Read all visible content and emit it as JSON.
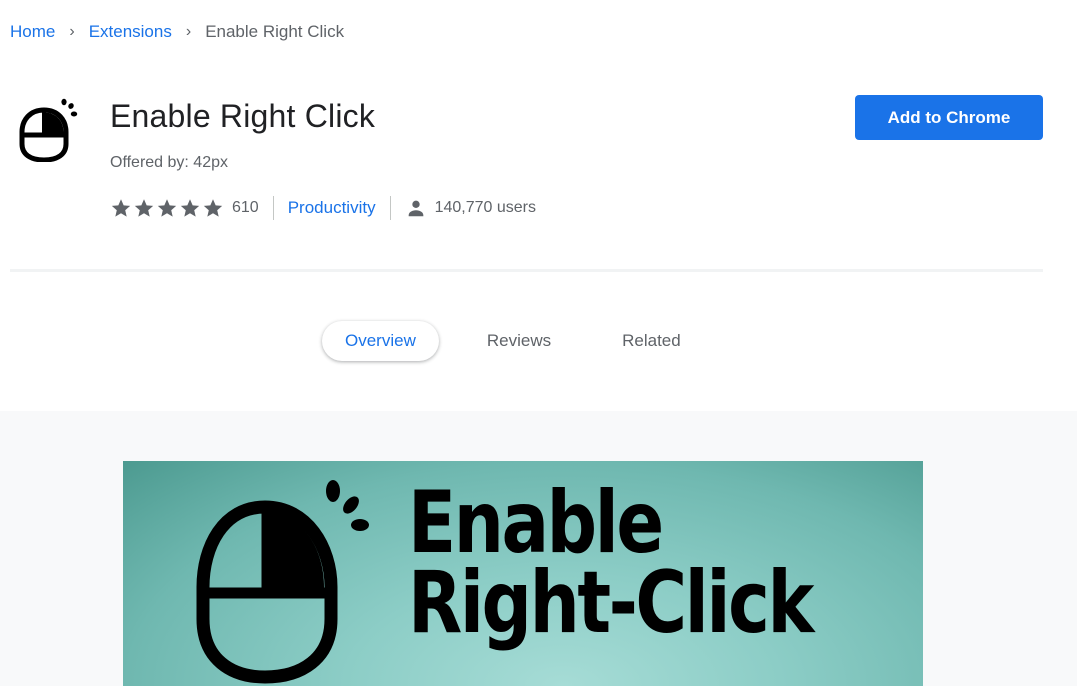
{
  "breadcrumb": {
    "items": [
      {
        "label": "Home",
        "link": true
      },
      {
        "label": "Extensions",
        "link": true
      },
      {
        "label": "Enable Right Click",
        "link": false
      }
    ],
    "separator_icon": "chevron-right-icon"
  },
  "extension": {
    "icon": "mouse-right-click-icon",
    "title": "Enable Right Click",
    "offered_by": "Offered by: 42px",
    "rating": {
      "stars": 5,
      "max": 5,
      "count": "610"
    },
    "category": "Productivity",
    "users_icon": "person-icon",
    "users": "140,770 users"
  },
  "actions": {
    "add_button_label": "Add to Chrome",
    "accent_color": "#1a73e8"
  },
  "tabs": [
    {
      "label": "Overview",
      "active": true
    },
    {
      "label": "Reviews",
      "active": false
    },
    {
      "label": "Related",
      "active": false
    }
  ],
  "gallery": {
    "promo_line1": "Enable",
    "promo_line2": "Right-Click",
    "promo_icon": "mouse-right-click-icon"
  }
}
